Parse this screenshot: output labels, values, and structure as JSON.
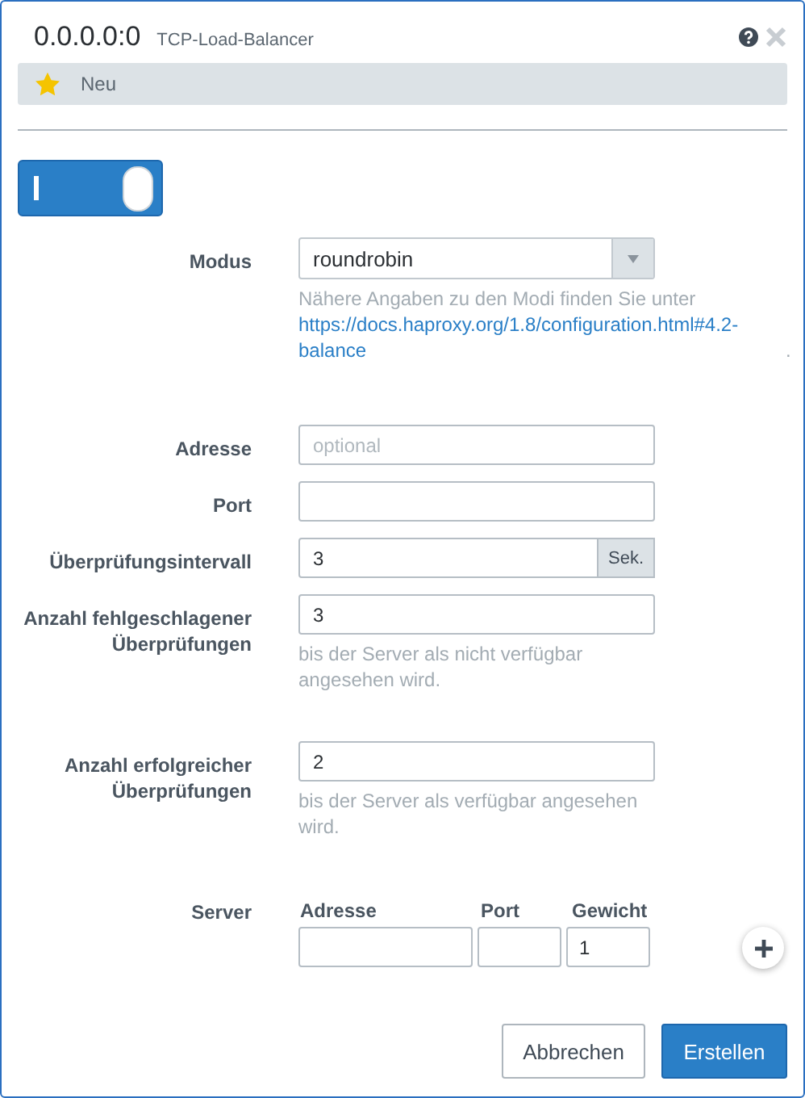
{
  "window": {
    "title": "0.0.0.0:0",
    "subtitle": "TCP-Load-Balancer"
  },
  "status": {
    "label": "Neu"
  },
  "toggle": {
    "on": true
  },
  "fields": [
    {
      "kind": "select",
      "label": "Modus",
      "value": "roundrobin",
      "help": {
        "before": "Nähere Angaben zu den Modi finden Sie unter",
        "link": "https://docs.haproxy.org/1.8/configuration.html#4.2-balance",
        "after": "."
      }
    },
    {
      "kind": "text",
      "label": "Adresse",
      "placeholder": "optional"
    },
    {
      "kind": "text",
      "label": "Port"
    },
    {
      "kind": "unit",
      "label": "Überprüfungsintervall",
      "value": "3",
      "unit": "Sek."
    },
    {
      "kind": "text",
      "label": "Anzahl fehlgeschlagener Überprüfungen",
      "value": "3",
      "help": {
        "before": "bis der Server als nicht verfügbar angesehen wird."
      }
    },
    {
      "kind": "text",
      "label": "Anzahl erfolgreicher Überprüfungen",
      "value": "2",
      "help": {
        "before": "bis der Server als verfügbar angesehen wird."
      }
    },
    {
      "kind": "servers",
      "label": "Server",
      "columns": [
        "Adresse",
        "Port",
        "Gewicht"
      ],
      "rows": [
        [
          "",
          "",
          "1"
        ]
      ]
    }
  ],
  "buttons": [
    {
      "label": "Abbrechen",
      "primary": false
    },
    {
      "label": "Erstellen",
      "primary": true
    }
  ]
}
